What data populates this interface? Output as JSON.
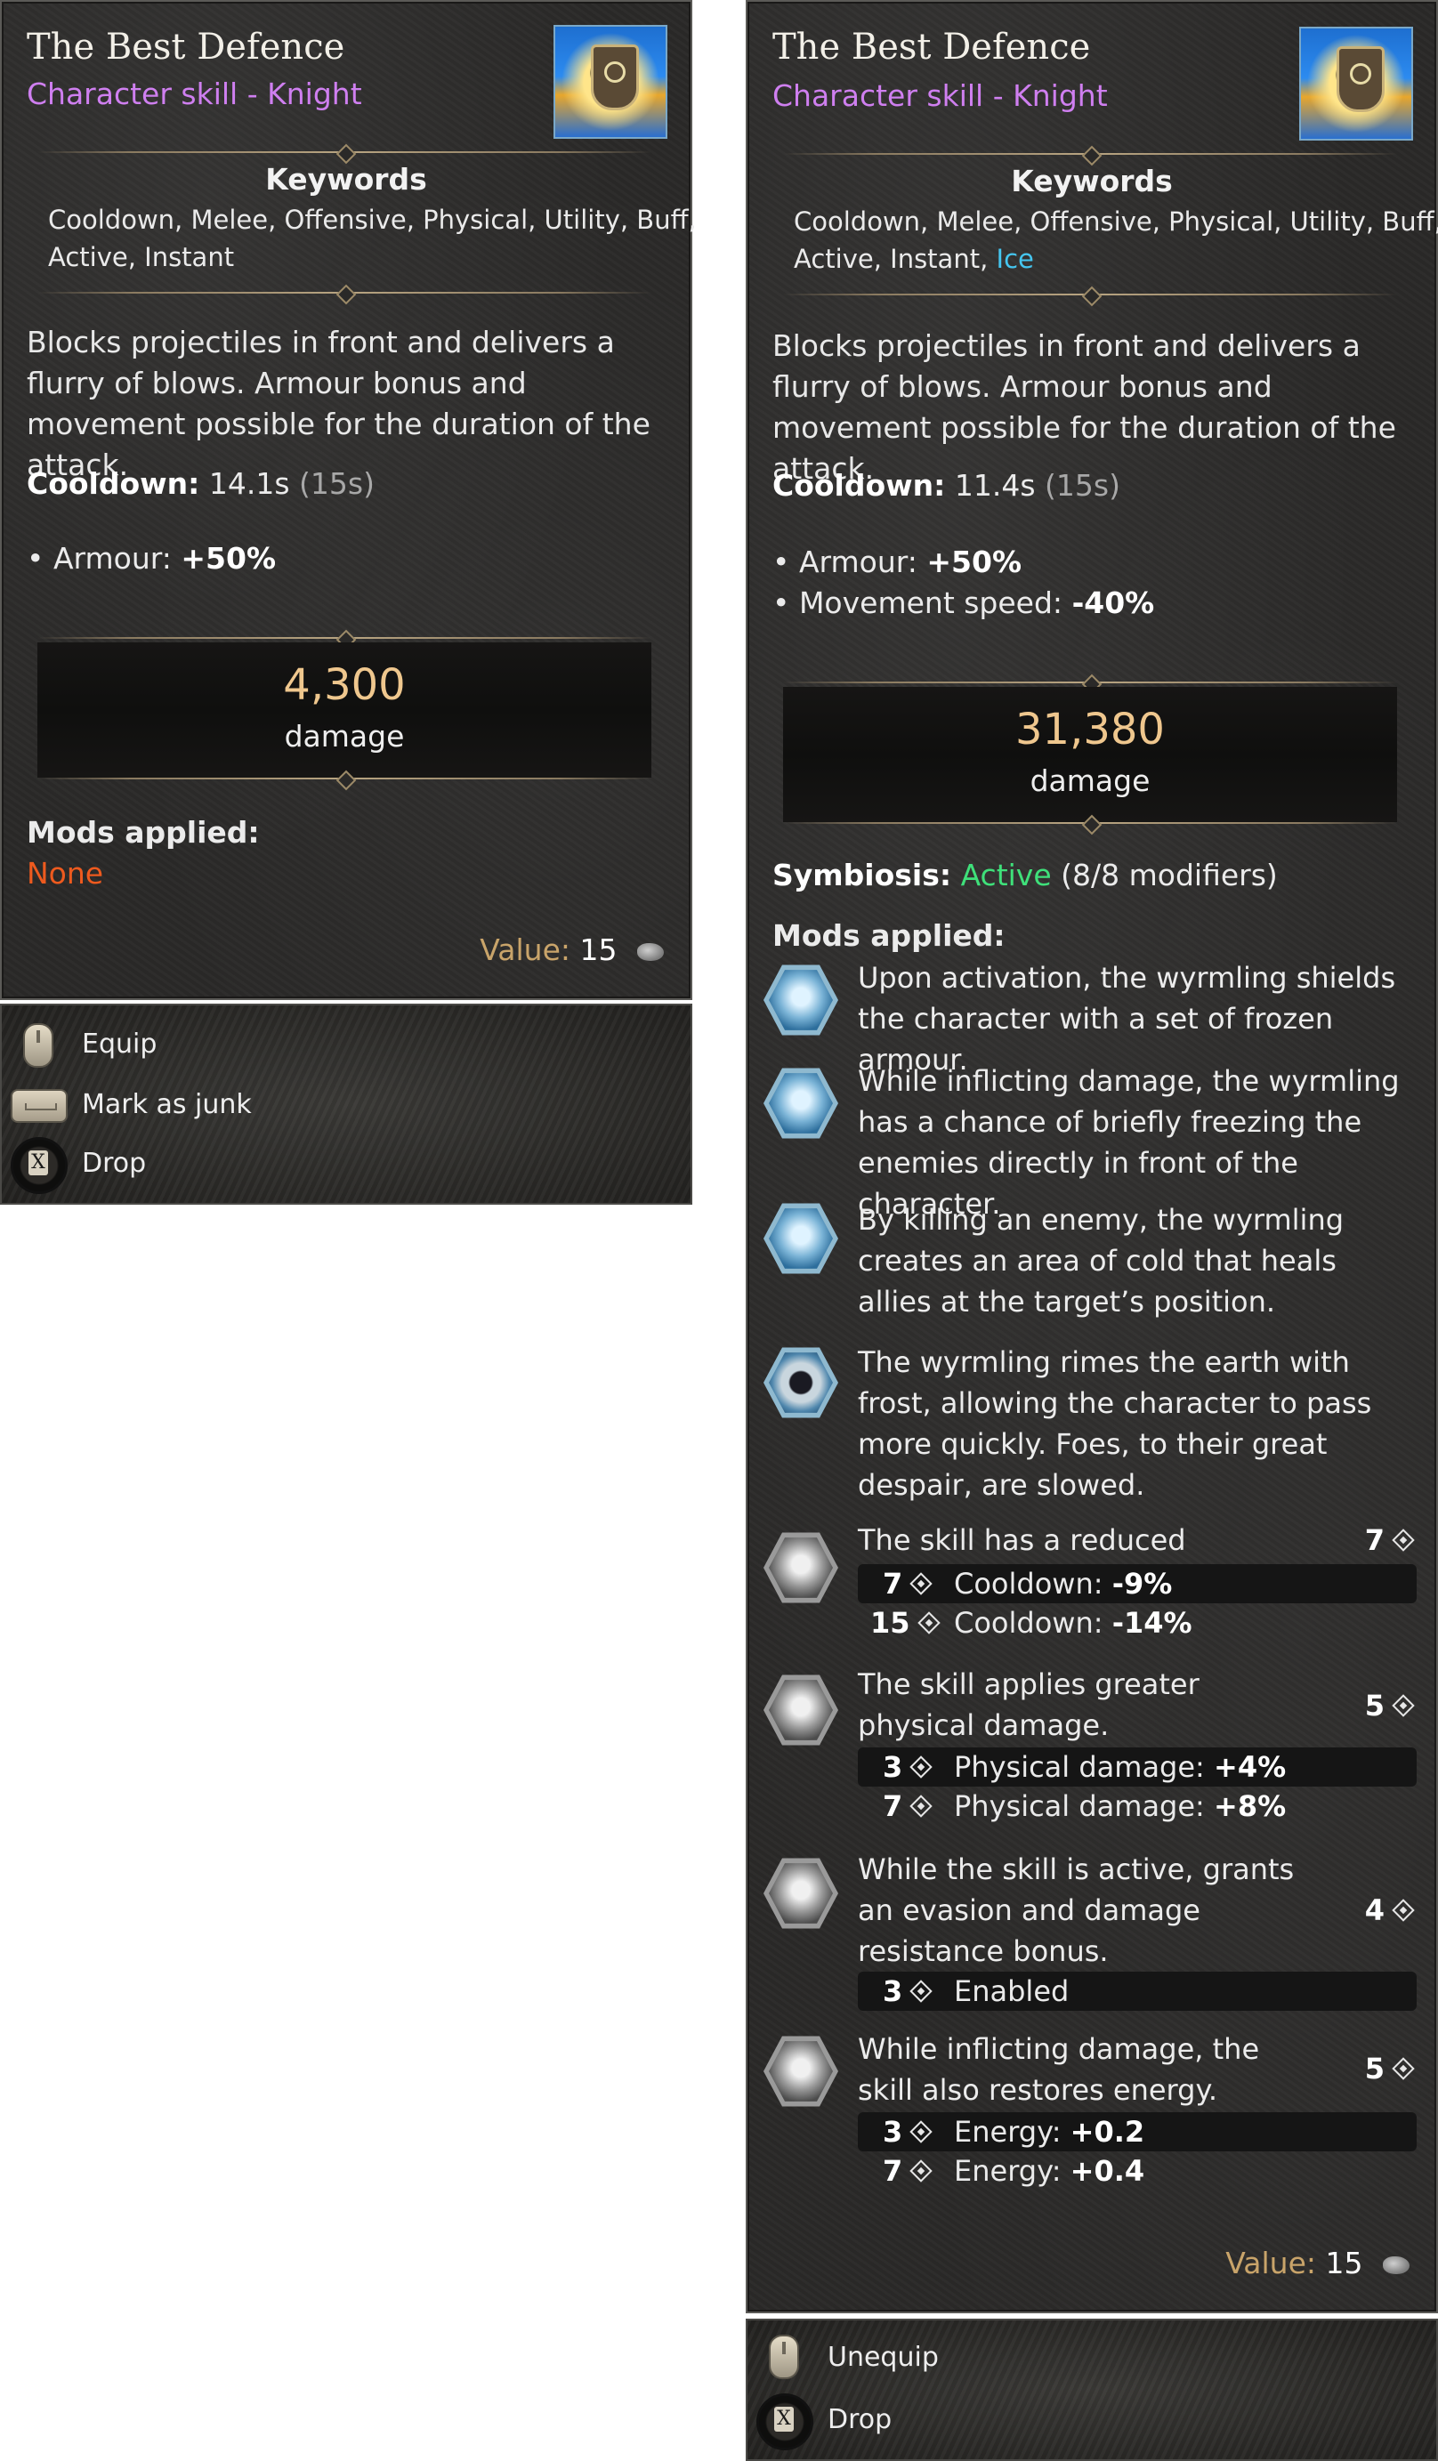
{
  "left": {
    "title": "The Best Defence",
    "subtitle": "Character skill - Knight",
    "icon": "shield-skill-icon",
    "keywords_heading": "Keywords",
    "keywords_line1": "Cooldown, Melee, Offensive, Physical, Utility, Buff,",
    "keywords_line2": "Active, Instant",
    "description": "Blocks projectiles in front and delivers a flurry of blows. Armour bonus and movement possible for the duration of the attack.",
    "cooldown_label": "Cooldown:",
    "cooldown_value": "14.1s",
    "cooldown_base": "(15s)",
    "stats": [
      {
        "label": "• Armour:",
        "value": "+50%"
      }
    ],
    "damage_value": "4,300",
    "damage_label": "damage",
    "mods_heading": "Mods applied:",
    "mods_none": "None",
    "value_label": "Value:",
    "value_amount": "15",
    "actions": [
      {
        "label": "Equip",
        "button": "mouse-button-icon"
      },
      {
        "label": "Mark as junk",
        "button": "spacebar-key-icon"
      },
      {
        "label": "Drop",
        "button": "x-button-icon"
      }
    ]
  },
  "right": {
    "title": "The Best Defence",
    "subtitle": "Character skill - Knight",
    "icon": "shield-skill-icon",
    "keywords_heading": "Keywords",
    "keywords_line1": "Cooldown, Melee, Offensive, Physical, Utility, Buff,",
    "keywords_line2": "Active, Instant, ",
    "keywords_ice": "Ice",
    "description": "Blocks projectiles in front and delivers a flurry of blows. Armour bonus and movement possible for the duration of the attack.",
    "cooldown_label": "Cooldown:",
    "cooldown_value": "11.4s",
    "cooldown_base": "(15s)",
    "stats": [
      {
        "label": "• Armour:",
        "value": "+50%"
      },
      {
        "label": "• Movement speed:",
        "value": "-40%"
      }
    ],
    "damage_value": "31,380",
    "damage_label": "damage",
    "symbiosis_label": "Symbiosis:",
    "symbiosis_status": "Active",
    "symbiosis_count": "(8/8 modifiers)",
    "mods_heading": "Mods applied:",
    "ice_mods": [
      {
        "text": "Upon activation, the wyrmling shields the character with a set of frozen armour.",
        "icon": "frost-armour-icon"
      },
      {
        "text": "While inflicting damage, the wyrmling has a chance of briefly freezing the enemies directly in front of the character.",
        "icon": "ice-crystal-icon"
      },
      {
        "text": "By killing an enemy, the wyrmling creates an area of cold that heals allies at the target’s position.",
        "icon": "frost-orb-icon"
      },
      {
        "text": "The wyrmling rimes the earth with frost, allowing the character to pass more quickly. Foes, to their great despair, are slowed.",
        "icon": "frost-eye-icon"
      }
    ],
    "mods": [
      {
        "text": "The skill has a reduced cooldown.",
        "rank": "7",
        "icon": "stopwatch-icon",
        "tiers": [
          {
            "tier": "7",
            "label": "Cooldown:",
            "value": "-9%"
          },
          {
            "tier": "15",
            "label": "Cooldown:",
            "value": "-14%"
          }
        ]
      },
      {
        "text": "The skill applies greater physical damage.",
        "rank": "5",
        "icon": "sword-icon",
        "tiers": [
          {
            "tier": "3",
            "label": "Physical damage:",
            "value": "+4%"
          },
          {
            "tier": "7",
            "label": "Physical damage:",
            "value": "+8%"
          }
        ]
      },
      {
        "text": "While the skill is active, grants an evasion and damage resistance bonus.",
        "rank": "4",
        "icon": "evasion-icon",
        "tiers": [
          {
            "tier": "3",
            "label": "Enabled",
            "value": ""
          }
        ]
      },
      {
        "text": "While inflicting damage, the skill also restores energy.",
        "rank": "5",
        "icon": "energy-restore-icon",
        "tiers": [
          {
            "tier": "3",
            "label": "Energy:",
            "value": "+0.2"
          },
          {
            "tier": "7",
            "label": "Energy:",
            "value": "+0.4"
          }
        ]
      }
    ],
    "value_label": "Value:",
    "value_amount": "15",
    "actions": [
      {
        "label": "Unequip",
        "button": "mouse-button-icon"
      },
      {
        "label": "Drop",
        "button": "x-button-icon"
      }
    ]
  },
  "colors": {
    "subtitle": "#cf7ff0",
    "damage": "#efc78e",
    "none": "#ee5a1e",
    "active": "#3fe07a",
    "ice_keyword": "#45c6f0",
    "value_label": "#c9a46a"
  }
}
